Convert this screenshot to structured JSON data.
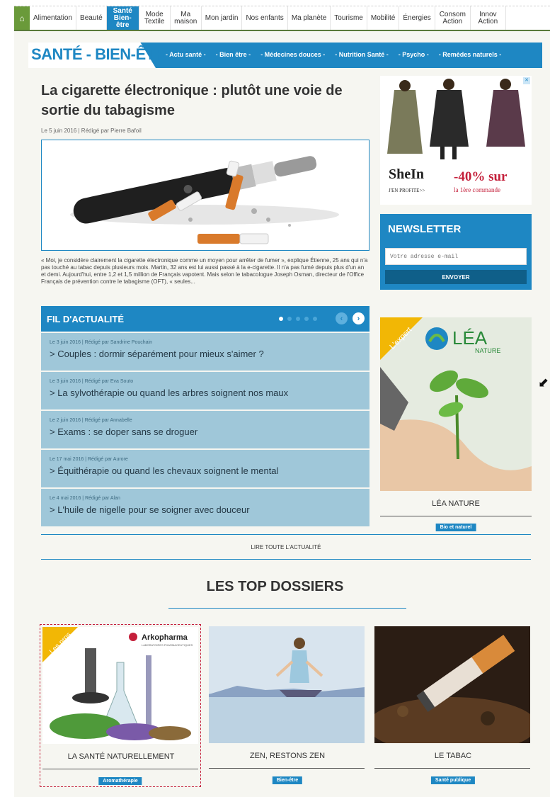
{
  "nav": {
    "items": [
      {
        "label": "Alimentation"
      },
      {
        "label": "Beauté"
      },
      {
        "label": "Santé Bien-être",
        "active": true
      },
      {
        "label": "Mode Textile"
      },
      {
        "label": "Ma maison"
      },
      {
        "label": "Mon jardin"
      },
      {
        "label": "Nos enfants"
      },
      {
        "label": "Ma planète"
      },
      {
        "label": "Tourisme"
      },
      {
        "label": "Mobilité"
      },
      {
        "label": "Énergies"
      },
      {
        "label": "Consom Action"
      },
      {
        "label": "Innov Action"
      }
    ]
  },
  "section": {
    "title": "SANTÉ - BIEN-ÊTRE",
    "links": [
      "- Actu santé -",
      "- Bien être -",
      "- Médecines douces -",
      "- Nutrition Santé -",
      "- Psycho -",
      "- Remèdes naturels -"
    ]
  },
  "article": {
    "title": "La cigarette électronique : plutôt une voie de sortie du tabagisme",
    "meta": "Le 5 juin 2016 | Rédigé par Pierre Bafoil",
    "excerpt": "« Moi, je considère clairement la cigarette électronique comme un moyen pour arrêter de fumer », explique Étienne, 25 ans qui n'a pas touché au tabac depuis plusieurs mois. Martin, 32 ans est lui aussi passé à la e-cigarette. Il n'a pas fumé depuis plus d'un an et demi. Aujourd'hui, entre 1,2 et 1,5 million de Français vapotent. Mais selon le tabacologue Joseph Osman, directeur de l'Office Français de prévention contre le tabagisme (OFT), « seules..."
  },
  "fil": {
    "title": "FIL D'ACTUALITÉ",
    "items": [
      {
        "meta": "Le 3 juin 2016 | Rédigé par Sandrine Pouchain",
        "title": "> Couples : dormir séparément pour mieux s'aimer ?"
      },
      {
        "meta": "Le 3 juin 2016 | Rédigé par Eva Souto",
        "title": "> La sylvothérapie ou quand les arbres soignent nos maux"
      },
      {
        "meta": "Le 2 juin 2016 | Rédigé par Annabelle",
        "title": "> Exams : se doper sans se droguer"
      },
      {
        "meta": "Le 17 mai 2016 | Rédigé par Aurore",
        "title": "> Équithérapie ou quand les chevaux soignent le mental"
      },
      {
        "meta": "Le 4 mai 2016 | Rédigé par Alan",
        "title": "> L'huile de nigelle pour se soigner avec douceur"
      }
    ],
    "read_all": "LIRE TOUTE L'ACTUALITÉ"
  },
  "top": {
    "title": "LES TOP DOSSIERS",
    "dossiers": [
      {
        "label": "LA SANTÉ NATURELLEMENT",
        "badge": "Aromathérapie",
        "ribbon": "Les pros",
        "brand": "Arkopharma",
        "brand_sub": "LABORATOIRES PHARMACEUTIQUES"
      },
      {
        "label": "ZEN, RESTONS ZEN",
        "badge": "Bien-être"
      },
      {
        "label": "LE TABAC",
        "badge": "Santé publique"
      }
    ]
  },
  "sidebar": {
    "ad": {
      "brand": "SheIn",
      "cta": "J'EN PROFITE>>",
      "discount": "-40% sur",
      "sub": "la 1ère commande"
    },
    "newsletter": {
      "title": "NEWSLETTER",
      "placeholder": "Votre adresse e-mail",
      "button": "ENVOYER"
    },
    "expert": {
      "ribbon": "L'expert",
      "brand": "LÉA",
      "brand_sub": "NATURE",
      "label": "LÉA NATURE",
      "badge": "Bio et naturel"
    }
  },
  "colors": {
    "accent": "#1e87c3",
    "fil_item": "#9fc7d9",
    "ribbon": "#f2b705",
    "red": "#c41f3a",
    "nav_green": "#6a9a3a"
  }
}
